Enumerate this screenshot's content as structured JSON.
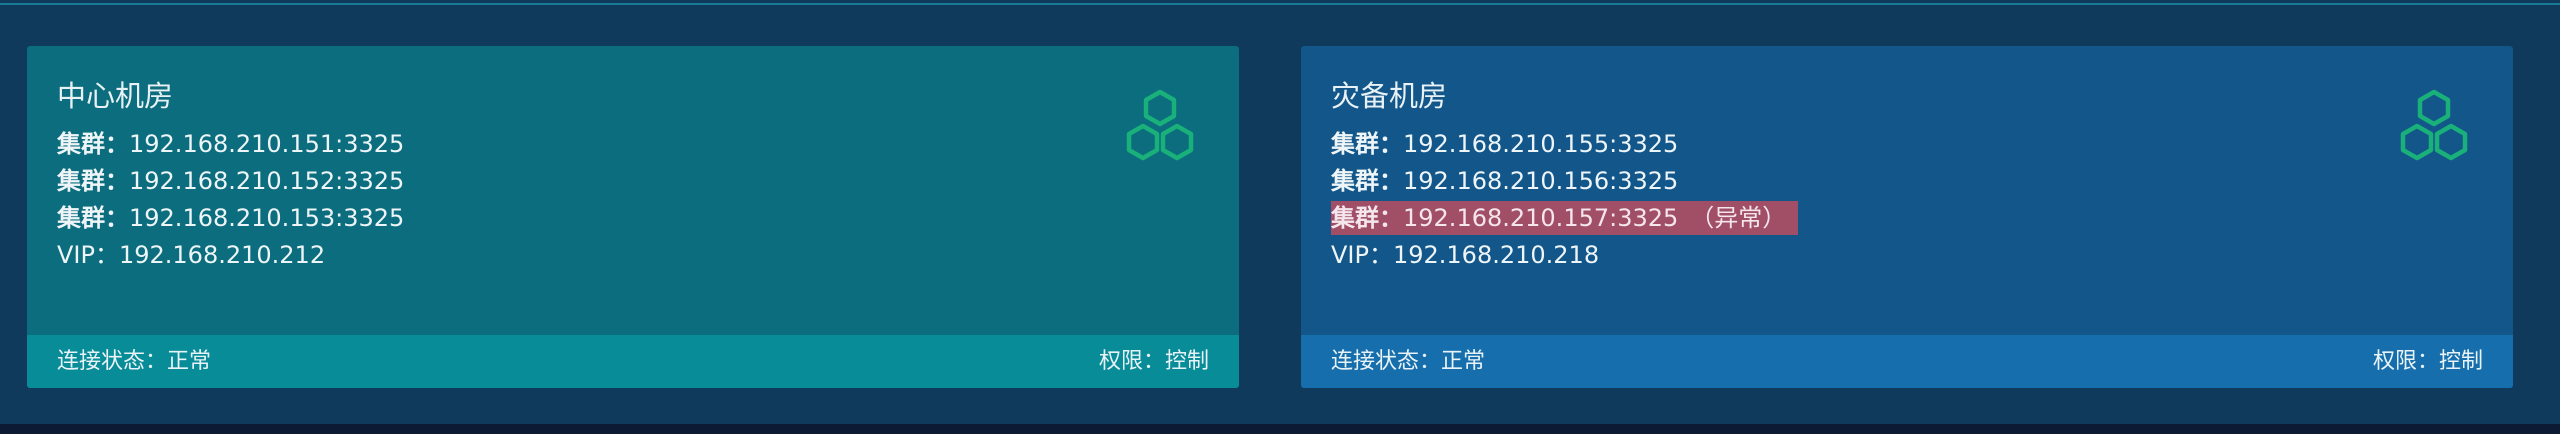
{
  "colors": {
    "background": "#0f3a5c",
    "left_card": "#0b6d7d",
    "left_footer": "#078c98",
    "right_card": "#12568a",
    "right_footer": "#166fac",
    "alert_highlight": "#a14e67",
    "icon_green": "#19b07a"
  },
  "cards": [
    {
      "title": "中心机房",
      "icon": "cluster-hexagons-icon",
      "clusters": [
        {
          "label": "集群：",
          "address": "192.168.210.151:3325"
        },
        {
          "label": "集群：",
          "address": "192.168.210.152:3325"
        },
        {
          "label": "集群：",
          "address": "192.168.210.153:3325"
        }
      ],
      "vip": {
        "label": "VIP：",
        "address": "192.168.210.212"
      },
      "footer": {
        "status": "连接状态：正常",
        "permission": "权限：控制"
      }
    },
    {
      "title": "灾备机房",
      "icon": "cluster-hexagons-icon",
      "clusters": [
        {
          "label": "集群：",
          "address": "192.168.210.155:3325"
        },
        {
          "label": "集群：",
          "address": "192.168.210.156:3325"
        },
        {
          "label": "集群：",
          "address": "192.168.210.157:3325",
          "suffix": "（异常）"
        }
      ],
      "vip": {
        "label": "VIP：",
        "address": "192.168.210.218"
      },
      "footer": {
        "status": "连接状态：正常",
        "permission": "权限：控制"
      }
    }
  ]
}
